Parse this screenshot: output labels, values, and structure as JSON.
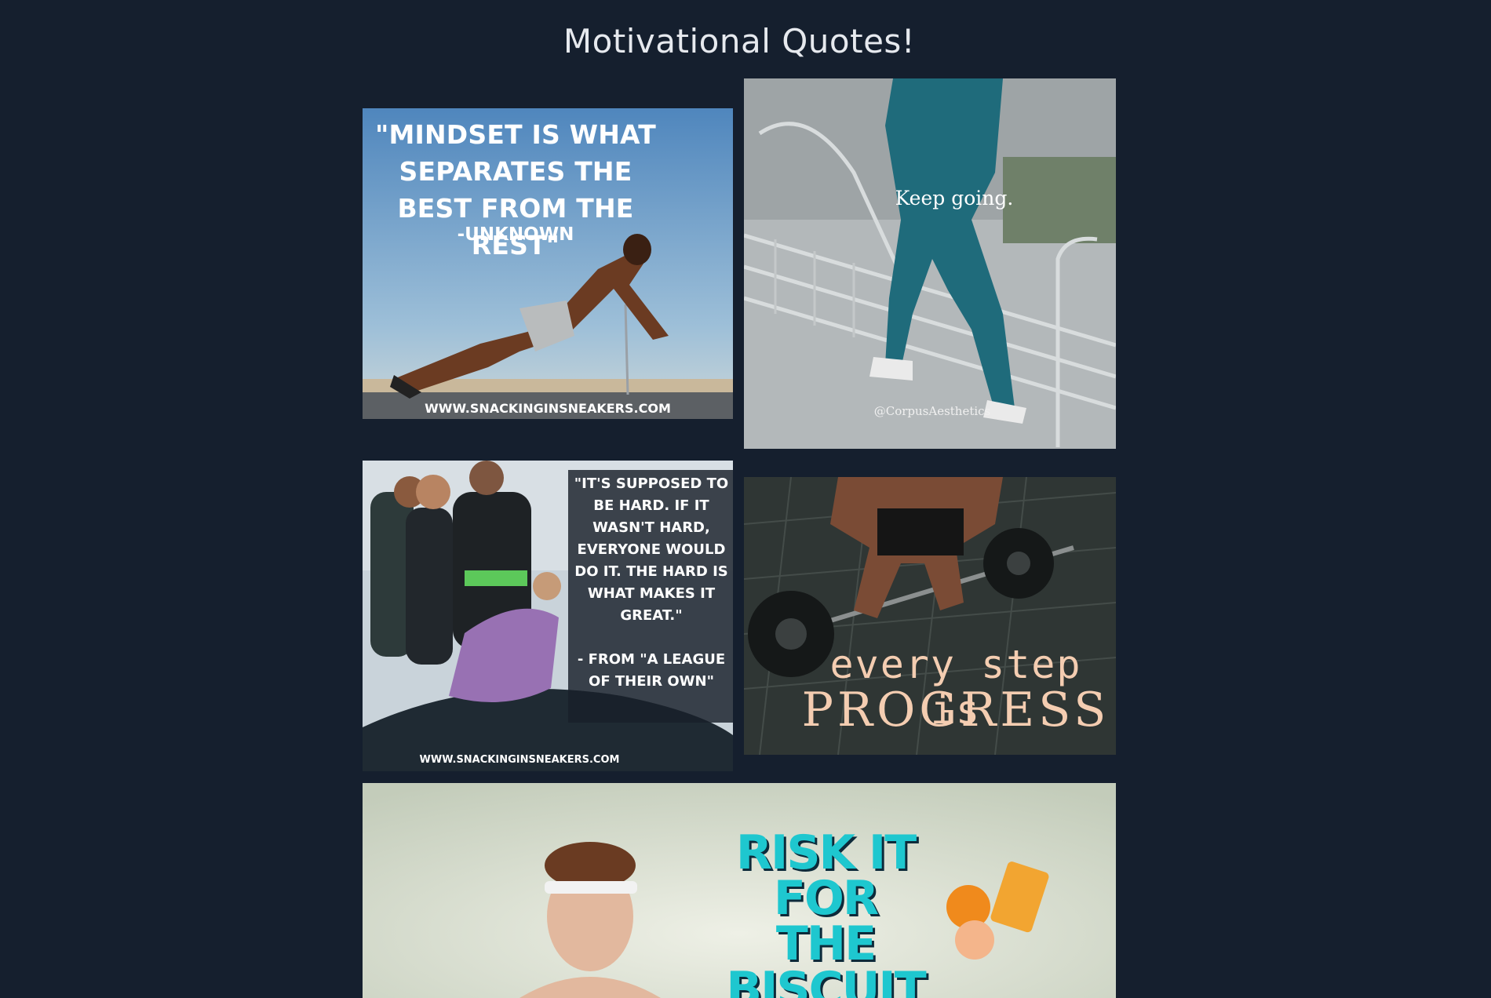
{
  "page": {
    "title": "Motivational Quotes!"
  },
  "tiles": [
    {
      "quote": "\"MINDSET IS WHAT SEPARATES THE BEST FROM THE REST\"",
      "author": "-UNKNOWN",
      "url": "WWW.SNACKINGINSNEAKERS.COM"
    },
    {
      "caption": "Keep going.",
      "handle": "@CorpusAesthetics"
    },
    {
      "quote": "\"IT'S SUPPOSED TO BE HARD.  IF IT WASN'T HARD, EVERYONE WOULD DO IT.  THE HARD IS WHAT MAKES IT GREAT.\"\n\n- FROM \"A LEAGUE OF THEIR OWN\"",
      "url": "WWW.SNACKINGINSNEAKERS.COM"
    },
    {
      "line1": "every step is",
      "line2": "PROGRESS"
    },
    {
      "title": "RISK IT FOR\nTHE\nBISCUIT"
    }
  ],
  "colors": {
    "background": "#151f2e",
    "title_text": "#e6e9ee",
    "biscuit_accent": "#1ec7cf",
    "progress_text": "#f4cdb1"
  }
}
